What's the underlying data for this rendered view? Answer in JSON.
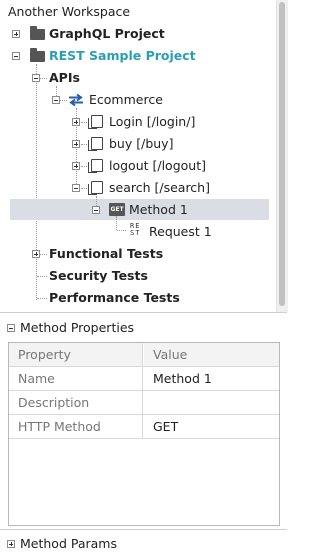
{
  "tree": {
    "workspace": "Another Workspace",
    "projects": [
      {
        "label": "GraphQL Project"
      },
      {
        "label": "REST Sample Project"
      }
    ],
    "apis": "APIs",
    "service": "Ecommerce",
    "resources": [
      {
        "label": "Login [/login/]"
      },
      {
        "label": "buy [/buy]"
      },
      {
        "label": "logout [/logout]"
      },
      {
        "label": "search [/search]"
      }
    ],
    "method": {
      "badge": "GET",
      "label": "Method 1"
    },
    "request": {
      "badge_top": "RE",
      "badge_bottom": "ST",
      "label": "Request 1"
    },
    "functional_tests": "Functional Tests",
    "security_tests": "Security Tests",
    "performance_tests": "Performance Tests"
  },
  "method_properties": {
    "title": "Method Properties",
    "columns": [
      "Property",
      "Value"
    ],
    "rows": [
      {
        "property": "Name",
        "value": "Method 1"
      },
      {
        "property": "Description",
        "value": ""
      },
      {
        "property": "HTTP Method",
        "value": "GET"
      }
    ]
  },
  "method_params": {
    "title": "Method Params"
  },
  "colors": {
    "project_active": "#2a9fb3",
    "selection": "#dadee4",
    "icon_dark": "#555555"
  }
}
